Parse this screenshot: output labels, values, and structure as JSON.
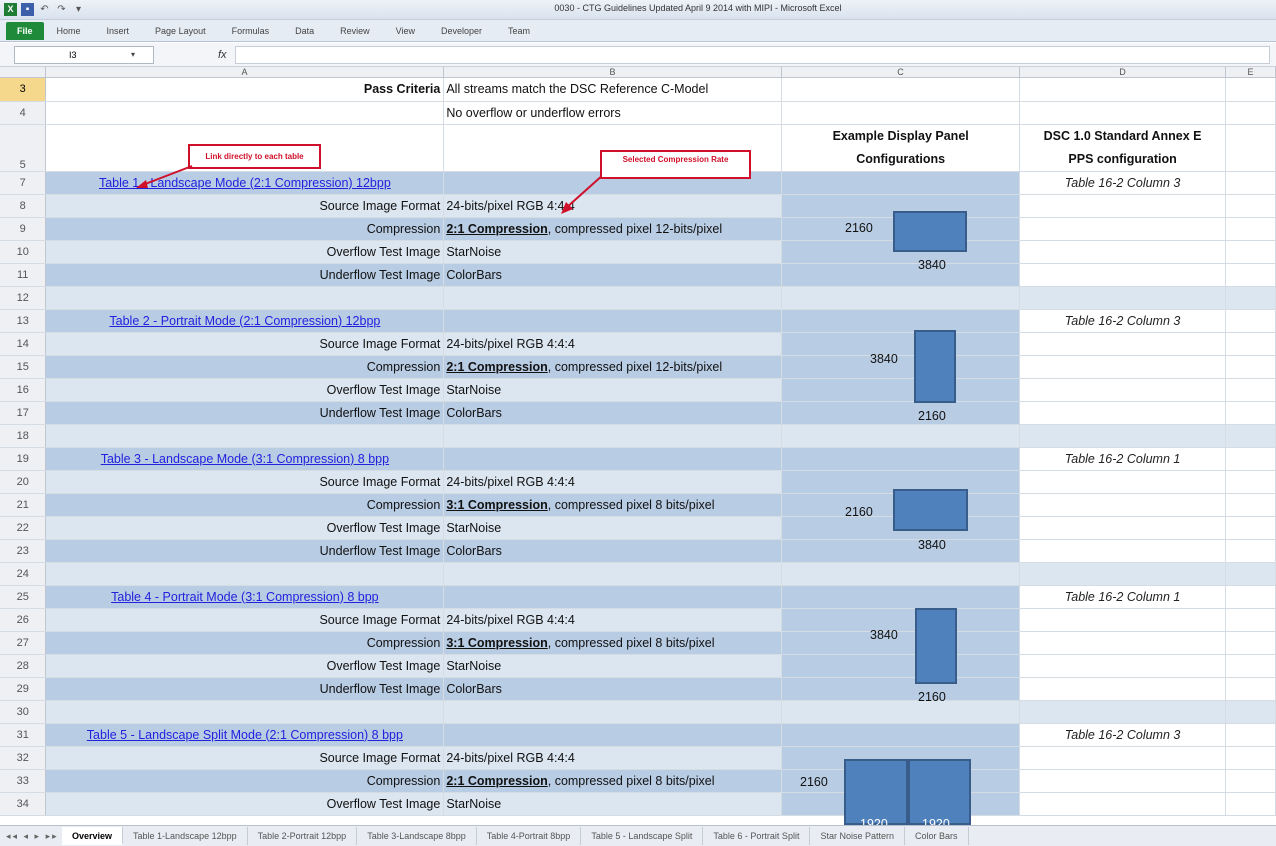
{
  "window": {
    "title": "0030 - CTG Guidelines Updated April 9 2014 with MIPI - Microsoft Excel"
  },
  "ribbon": {
    "tabs": [
      "File",
      "Home",
      "Insert",
      "Page Layout",
      "Formulas",
      "Data",
      "Review",
      "View",
      "Developer",
      "Team"
    ]
  },
  "formula_bar": {
    "cell_ref": "I3",
    "fx": "fx",
    "value": ""
  },
  "columns": [
    "A",
    "B",
    "C",
    "D",
    "E"
  ],
  "rows": {
    "r3": {
      "num": "3",
      "a": "Pass Criteria",
      "b": "All streams match the DSC Reference C-Model"
    },
    "r4": {
      "num": "4",
      "b": "No overflow or underflow errors"
    },
    "r5": {
      "num": "5",
      "c": "Example Display Panel Configurations",
      "d": "DSC 1.0 Standard Annex E PPS configuration",
      "c_line1": "Example Display Panel",
      "c_line2": "Configurations",
      "d_line1": "DSC 1.0 Standard Annex E",
      "d_line2": "PPS configuration"
    },
    "r7": {
      "num": "7",
      "a": "Table 1 - Landscape Mode (2:1 Compression) 12bpp",
      "d": "Table 16-2 Column 3"
    },
    "r8": {
      "num": "8",
      "a": "Source Image Format",
      "b": "24-bits/pixel RGB 4:4:4"
    },
    "r9": {
      "num": "9",
      "a": "Compression",
      "b_bold": "2:1 Compression",
      "b_rest": ", compressed pixel 12-bits/pixel"
    },
    "r10": {
      "num": "10",
      "a": "Overflow Test Image",
      "b": "StarNoise"
    },
    "r11": {
      "num": "11",
      "a": "Underflow Test Image",
      "b": "ColorBars"
    },
    "r12": {
      "num": "12"
    },
    "r13": {
      "num": "13",
      "a": "Table 2 - Portrait Mode (2:1 Compression) 12bpp",
      "d": "Table 16-2 Column 3"
    },
    "r14": {
      "num": "14",
      "a": "Source Image Format",
      "b": "24-bits/pixel RGB 4:4:4"
    },
    "r15": {
      "num": "15",
      "a": "Compression",
      "b_bold": "2:1 Compression",
      "b_rest": ", compressed pixel 12-bits/pixel"
    },
    "r16": {
      "num": "16",
      "a": "Overflow Test Image",
      "b": "StarNoise"
    },
    "r17": {
      "num": "17",
      "a": "Underflow Test Image",
      "b": "ColorBars"
    },
    "r18": {
      "num": "18"
    },
    "r19": {
      "num": "19",
      "a": "Table 3 - Landscape Mode (3:1 Compression) 8 bpp",
      "d": "Table 16-2 Column 1"
    },
    "r20": {
      "num": "20",
      "a": "Source Image Format",
      "b": "24-bits/pixel RGB 4:4:4"
    },
    "r21": {
      "num": "21",
      "a": "Compression",
      "b_bold": "3:1 Compression",
      "b_rest": ", compressed pixel 8 bits/pixel"
    },
    "r22": {
      "num": "22",
      "a": "Overflow Test Image",
      "b": "StarNoise"
    },
    "r23": {
      "num": "23",
      "a": "Underflow Test Image",
      "b": "ColorBars"
    },
    "r24": {
      "num": "24"
    },
    "r25": {
      "num": "25",
      "a": "Table 4 - Portrait Mode (3:1 Compression) 8 bpp",
      "d": "Table 16-2 Column 1"
    },
    "r26": {
      "num": "26",
      "a": "Source Image Format",
      "b": "24-bits/pixel RGB 4:4:4"
    },
    "r27": {
      "num": "27",
      "a": "Compression",
      "b_bold": "3:1 Compression",
      "b_rest": ", compressed pixel 8 bits/pixel"
    },
    "r28": {
      "num": "28",
      "a": "Overflow Test Image",
      "b": "StarNoise"
    },
    "r29": {
      "num": "29",
      "a": "Underflow Test Image",
      "b": "ColorBars"
    },
    "r30": {
      "num": "30"
    },
    "r31": {
      "num": "31",
      "a": "Table 5 - Landscape Split Mode (2:1 Compression) 8 bpp",
      "d": "Table 16-2 Column 3"
    },
    "r32": {
      "num": "32",
      "a": "Source Image Format",
      "b": "24-bits/pixel RGB 4:4:4"
    },
    "r33": {
      "num": "33",
      "a": "Compression",
      "b_bold": "2:1 Compression",
      "b_rest": ", compressed pixel 8 bits/pixel"
    },
    "r34": {
      "num": "34",
      "a": "Overflow Test Image",
      "b": "StarNoise"
    }
  },
  "panels": {
    "p1": {
      "h": "2160",
      "w": "3840"
    },
    "p2": {
      "h": "3840",
      "w": "2160"
    },
    "p3": {
      "h": "2160",
      "w": "3840"
    },
    "p4": {
      "h": "3840",
      "w": "2160"
    },
    "p5": {
      "h": "2160",
      "w1": "1920",
      "w2": "1920"
    }
  },
  "callouts": {
    "link": "Link directly to each table",
    "rate": "Selected Compression Rate"
  },
  "sheet_tabs": [
    "Overview",
    "Table 1-Landscape 12bpp",
    "Table 2-Portrait 12bpp",
    "Table 3-Landscape 8bpp",
    "Table 4-Portrait 8bpp",
    "Table 5 - Landscape Split",
    "Table 6 - Portrait Split",
    "Star Noise Pattern",
    "Color Bars"
  ],
  "sheet_nav": "◂◂ ◂ ▸ ▸▸",
  "colors": {
    "band_dark": "#b8cce4",
    "band_light": "#dce6f1",
    "panel": "#4f81bd",
    "callout": "#d0102a"
  }
}
